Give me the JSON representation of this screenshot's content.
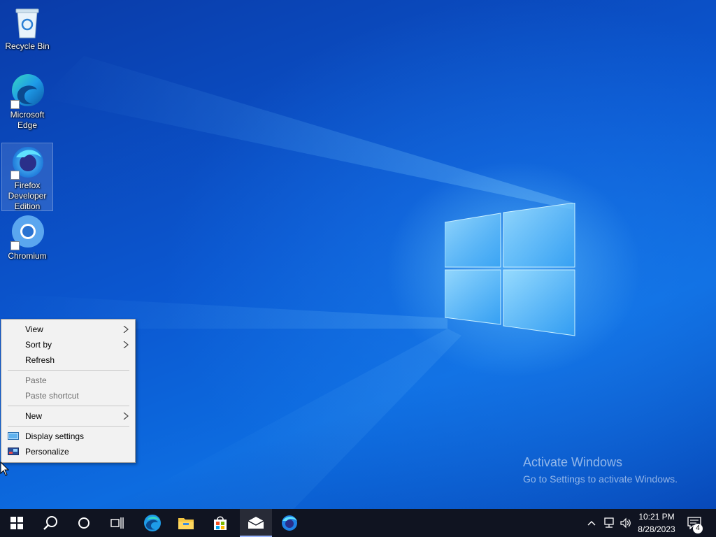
{
  "desktop_icons": {
    "recycle_bin": "Recycle Bin",
    "edge_line1": "Microsoft",
    "edge_line2": "Edge",
    "firefox_line1": "Firefox",
    "firefox_line2": "Developer",
    "firefox_line3": "Edition",
    "chromium": "Chromium"
  },
  "context_menu": {
    "view": "View",
    "sort_by": "Sort by",
    "refresh": "Refresh",
    "paste": "Paste",
    "paste_shortcut": "Paste shortcut",
    "new": "New",
    "display_settings": "Display settings",
    "personalize": "Personalize"
  },
  "watermark": {
    "title": "Activate Windows",
    "subtitle": "Go to Settings to activate Windows."
  },
  "taskbar": {
    "icons": [
      "windows-start-icon",
      "search-icon",
      "cortana-icon",
      "task-view-icon",
      "edge-icon",
      "file-explorer-icon",
      "microsoft-store-icon",
      "mail-icon",
      "firefox-developer-icon"
    ],
    "time": "10:21 PM",
    "date": "8/28/2023",
    "notification_count": "4"
  },
  "colors": {
    "taskbar": "#101421",
    "menu_bg": "#f2f2f2",
    "accent": "#0b57d0"
  }
}
